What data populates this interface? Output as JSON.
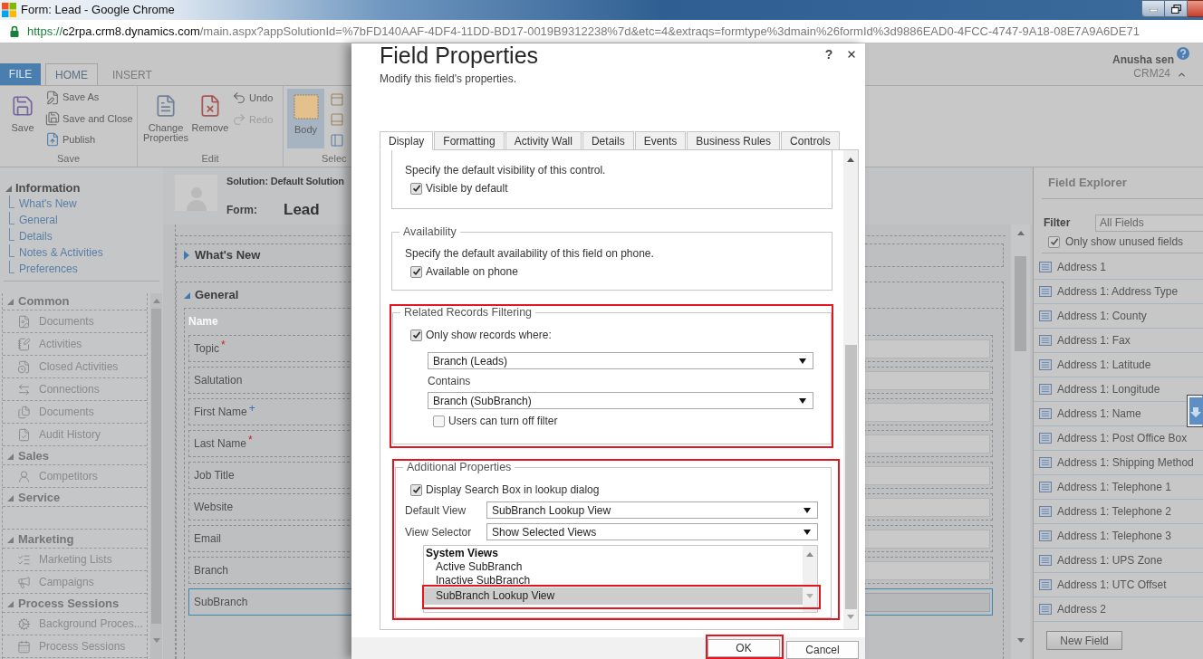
{
  "window": {
    "title": "Form: Lead - Google Chrome"
  },
  "address_bar": {
    "scheme": "https://",
    "host": "c2rpa.crm8.dynamics.com",
    "path": "/main.aspx?appSolutionId=%7bFD140AAF-4DF4-11DD-BD17-0019B9312238%7d&etc=4&extraqs=formtype%3dmain%26formId%3d9886EAD0-4FCC-4747-9A18-08E7A9A6DE71"
  },
  "ribbon": {
    "tabs": [
      {
        "label": "FILE",
        "kind": "file",
        "selected": false
      },
      {
        "label": "HOME",
        "kind": "tab",
        "selected": true
      },
      {
        "label": "INSERT",
        "kind": "tab",
        "selected": false
      }
    ],
    "groups": [
      {
        "label": "Save",
        "buttons": [
          {
            "label": "Save",
            "kind": "large",
            "disabled": false
          },
          {
            "label": "Save As",
            "kind": "small",
            "disabled": false
          },
          {
            "label": "Save and Close",
            "kind": "small",
            "disabled": false
          },
          {
            "label": "Publish",
            "kind": "small",
            "disabled": false
          }
        ]
      },
      {
        "label": "Edit",
        "buttons": [
          {
            "label": "Change Properties",
            "kind": "large",
            "disabled": false
          },
          {
            "label": "Remove",
            "kind": "large",
            "disabled": false
          },
          {
            "label": "Undo",
            "kind": "small",
            "disabled": false
          },
          {
            "label": "Redo",
            "kind": "small",
            "disabled": true
          }
        ]
      },
      {
        "label": "Selec",
        "buttons": [
          {
            "label": "Body",
            "kind": "large",
            "disabled": false,
            "selected": true
          },
          {
            "kind": "icon",
            "disabled": false
          },
          {
            "kind": "icon",
            "disabled": false
          },
          {
            "kind": "icon",
            "disabled": false
          }
        ]
      }
    ]
  },
  "user": {
    "name": "Anusha sen",
    "org": "CRM24"
  },
  "left_nav": {
    "title": "Information",
    "expanded": true,
    "items": [
      "What's New",
      "General",
      "Details",
      "Notes & Activities",
      "Preferences"
    ],
    "groups": [
      {
        "title": "Common",
        "expanded": true,
        "items": [
          "Documents",
          "Activities",
          "Closed Activities",
          "Connections",
          "Documents",
          "Audit History"
        ]
      },
      {
        "title": "Sales",
        "expanded": true,
        "items": [
          "Competitors"
        ]
      },
      {
        "title": "Service",
        "expanded": true
      },
      {
        "title": "Marketing",
        "expanded": true,
        "items": [
          "Marketing Lists",
          "Campaigns"
        ]
      },
      {
        "title": "Process Sessions",
        "expanded": true,
        "items": [
          "Background Proces...",
          "Process Sessions"
        ]
      }
    ]
  },
  "form": {
    "solution": "Solution: Default Solution",
    "form_label": "Form:",
    "form_name": "Lead",
    "sections": [
      {
        "title": "What's New",
        "expanded": false
      },
      {
        "title": "General",
        "expanded": true,
        "subheader": "Name",
        "fields": [
          {
            "label": "Topic",
            "kind": "required",
            "mark": "*",
            "selected": false
          },
          {
            "label": "Salutation",
            "selected": false
          },
          {
            "label": "First Name",
            "kind": "recommended",
            "mark": "+",
            "selected": false
          },
          {
            "label": "Last Name",
            "kind": "required",
            "mark": "*",
            "selected": false
          },
          {
            "label": "Job Title",
            "selected": false
          },
          {
            "label": "Website",
            "selected": false
          },
          {
            "label": "Email",
            "selected": false
          },
          {
            "label": "Branch",
            "selected": false
          },
          {
            "label": "SubBranch",
            "selected": true
          }
        ]
      }
    ]
  },
  "dialog": {
    "title": "Field Properties",
    "help": "?",
    "subtitle": "Modify this field's properties.",
    "tabs": [
      {
        "label": "Display",
        "selected": true
      },
      {
        "label": "Formatting",
        "selected": false
      },
      {
        "label": "Activity Wall",
        "selected": false
      },
      {
        "label": "Details",
        "selected": false
      },
      {
        "label": "Events",
        "selected": false
      },
      {
        "label": "Business Rules",
        "selected": false
      },
      {
        "label": "Controls",
        "selected": false
      }
    ],
    "visibility": {
      "description": "Specify the default visibility of this control.",
      "option": {
        "label": "Visible by default",
        "checked": true
      }
    },
    "availability": {
      "legend": "Availability",
      "description": "Specify the default availability of this field on phone.",
      "option": {
        "label": "Available on phone",
        "checked": true
      }
    },
    "related_records_filtering": {
      "legend": "Related Records Filtering",
      "annotated": true,
      "filter": {
        "label": "Only show records where:",
        "checked": true
      },
      "source": "Branch (Leads)",
      "operator": "Contains",
      "target": "Branch (SubBranch)",
      "user_toggle": {
        "label": "Users can turn off filter",
        "checked": false
      }
    },
    "additional_properties": {
      "legend": "Additional Properties",
      "annotated": true,
      "search_box": {
        "label": "Display Search Box in lookup dialog",
        "checked": true
      },
      "default_view": {
        "label": "Default View",
        "value": "SubBranch Lookup View"
      },
      "view_selector": {
        "label": "View Selector",
        "value": "Show Selected Views"
      },
      "views": {
        "header": "System Views",
        "items": [
          {
            "label": "Active SubBranch",
            "selected": false,
            "annotated": false
          },
          {
            "label": "Inactive SubBranch",
            "selected": false,
            "annotated": false
          },
          {
            "label": "SubBranch Lookup View",
            "selected": true,
            "annotated": true
          }
        ]
      }
    },
    "buttons": [
      {
        "label": "OK",
        "annotated": true
      },
      {
        "label": "Cancel",
        "annotated": false
      }
    ]
  },
  "field_explorer": {
    "title": "Field Explorer",
    "filter_label": "Filter",
    "filter_value": "All Fields",
    "unused_only": {
      "label": "Only show unused fields",
      "checked": true
    },
    "fields": [
      "Address 1",
      "Address 1: Address Type",
      "Address 1: County",
      "Address 1: Fax",
      "Address 1: Latitude",
      "Address 1: Longitude",
      "Address 1: Name",
      "Address 1: Post Office Box",
      "Address 1: Shipping Method",
      "Address 1: Telephone 1",
      "Address 1: Telephone 2",
      "Address 1: Telephone 3",
      "Address 1: UPS Zone",
      "Address 1: UTC Offset",
      "Address 2"
    ],
    "new_field": "New Field"
  }
}
